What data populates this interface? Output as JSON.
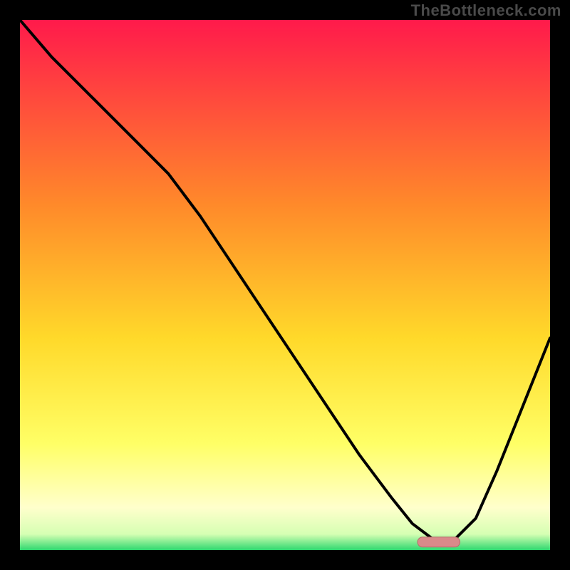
{
  "watermark": "TheBottleneck.com",
  "colors": {
    "frame": "#000000",
    "curve": "#000000",
    "marker_fill": "#d98a8a",
    "marker_stroke": "#b86a6a",
    "grad_top": "#ff1a4b",
    "grad_upper": "#ff8a2a",
    "grad_mid": "#ffd92a",
    "grad_lower": "#ffff66",
    "grad_pale": "#ffffcc",
    "grad_green": "#2fd86f"
  },
  "chart_data": {
    "type": "line",
    "title": "",
    "xlabel": "",
    "ylabel": "",
    "xlim": [
      0,
      100
    ],
    "ylim": [
      0,
      100
    ],
    "grid": false,
    "legend": false,
    "background_gradient": [
      {
        "pos": 0.0,
        "color": "#ff1a4b"
      },
      {
        "pos": 0.35,
        "color": "#ff8a2a"
      },
      {
        "pos": 0.6,
        "color": "#ffd92a"
      },
      {
        "pos": 0.8,
        "color": "#ffff66"
      },
      {
        "pos": 0.92,
        "color": "#ffffcc"
      },
      {
        "pos": 0.97,
        "color": "#d6ffb3"
      },
      {
        "pos": 1.0,
        "color": "#2fd86f"
      }
    ],
    "series": [
      {
        "name": "bottleneck-curve",
        "x": [
          0,
          6,
          14,
          22,
          28,
          34,
          40,
          46,
          52,
          58,
          64,
          70,
          74,
          78,
          82,
          86,
          90,
          94,
          98,
          100
        ],
        "values": [
          100,
          93,
          85,
          77,
          71,
          63,
          54,
          45,
          36,
          27,
          18,
          10,
          5,
          2,
          2,
          6,
          15,
          25,
          35,
          40
        ]
      }
    ],
    "marker": {
      "name": "optimal-range",
      "shape": "rounded-rect",
      "x_start": 75,
      "x_end": 83,
      "y": 1.5,
      "color": "#d98a8a"
    }
  }
}
